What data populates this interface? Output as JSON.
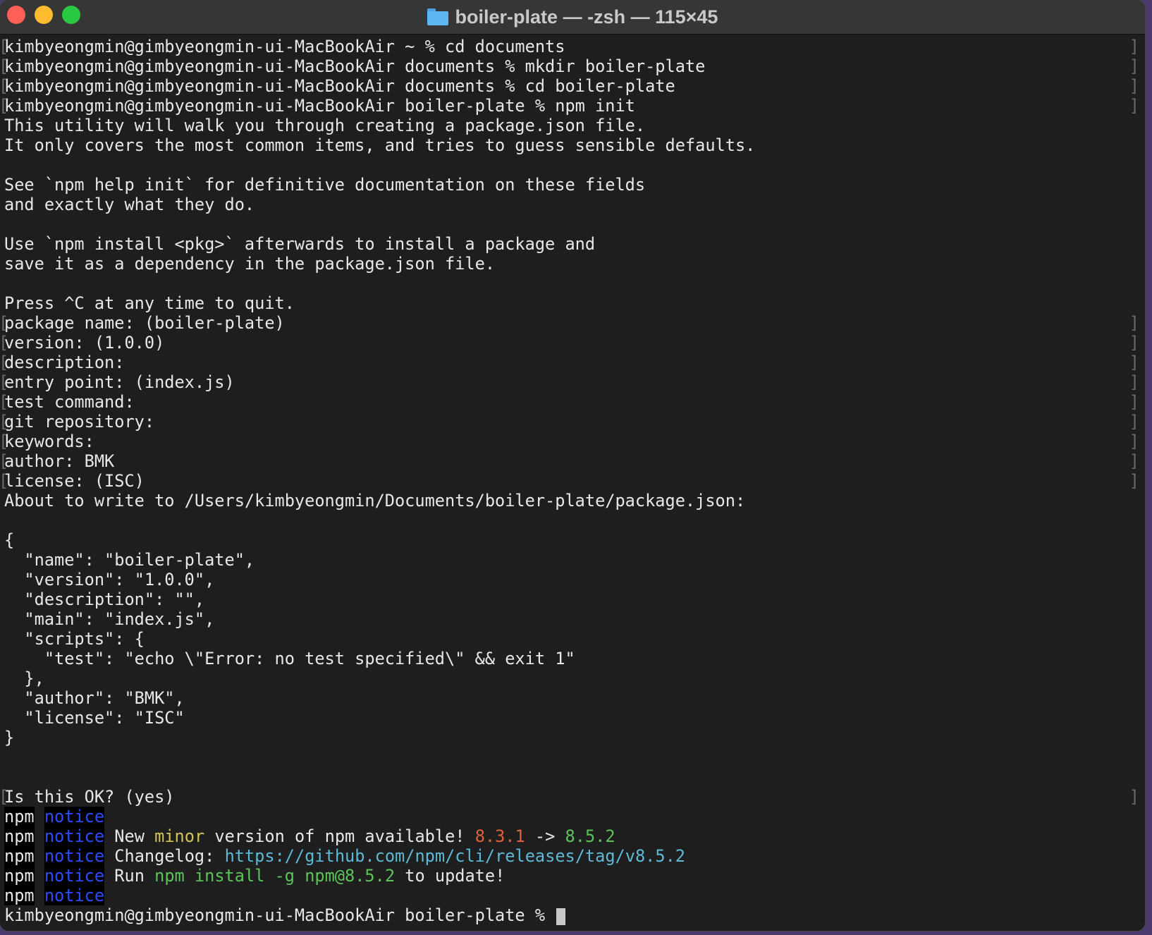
{
  "window": {
    "title": "boiler-plate — -zsh — 115×45"
  },
  "terminal": {
    "lines": [
      {
        "text": "kimbyeongmin@gimbyeongmin-ui-MacBookAir ~ % cd documents",
        "marked": true
      },
      {
        "text": "kimbyeongmin@gimbyeongmin-ui-MacBookAir documents % mkdir boiler-plate",
        "marked": true
      },
      {
        "text": "kimbyeongmin@gimbyeongmin-ui-MacBookAir documents % cd boiler-plate",
        "marked": true
      },
      {
        "text": "kimbyeongmin@gimbyeongmin-ui-MacBookAir boiler-plate % npm init",
        "marked": true
      },
      {
        "text": "This utility will walk you through creating a package.json file.",
        "marked": false
      },
      {
        "text": "It only covers the most common items, and tries to guess sensible defaults.",
        "marked": false
      },
      {
        "text": "",
        "marked": false
      },
      {
        "text": "See `npm help init` for definitive documentation on these fields",
        "marked": false
      },
      {
        "text": "and exactly what they do.",
        "marked": false
      },
      {
        "text": "",
        "marked": false
      },
      {
        "text": "Use `npm install <pkg>` afterwards to install a package and",
        "marked": false
      },
      {
        "text": "save it as a dependency in the package.json file.",
        "marked": false
      },
      {
        "text": "",
        "marked": false
      },
      {
        "text": "Press ^C at any time to quit.",
        "marked": false
      },
      {
        "text": "package name: (boiler-plate)",
        "marked": true
      },
      {
        "text": "version: (1.0.0)",
        "marked": true
      },
      {
        "text": "description:",
        "marked": true
      },
      {
        "text": "entry point: (index.js)",
        "marked": true
      },
      {
        "text": "test command:",
        "marked": true
      },
      {
        "text": "git repository:",
        "marked": true
      },
      {
        "text": "keywords:",
        "marked": true
      },
      {
        "text": "author: BMK",
        "marked": true
      },
      {
        "text": "license: (ISC)",
        "marked": true
      },
      {
        "text": "About to write to /Users/kimbyeongmin/Documents/boiler-plate/package.json:",
        "marked": false
      },
      {
        "text": "",
        "marked": false
      },
      {
        "text": "{",
        "marked": false
      },
      {
        "text": "  \"name\": \"boiler-plate\",",
        "marked": false
      },
      {
        "text": "  \"version\": \"1.0.0\",",
        "marked": false
      },
      {
        "text": "  \"description\": \"\",",
        "marked": false
      },
      {
        "text": "  \"main\": \"index.js\",",
        "marked": false
      },
      {
        "text": "  \"scripts\": {",
        "marked": false
      },
      {
        "text": "    \"test\": \"echo \\\"Error: no test specified\\\" && exit 1\"",
        "marked": false
      },
      {
        "text": "  },",
        "marked": false
      },
      {
        "text": "  \"author\": \"BMK\",",
        "marked": false
      },
      {
        "text": "  \"license\": \"ISC\"",
        "marked": false
      },
      {
        "text": "}",
        "marked": false
      },
      {
        "text": "",
        "marked": false
      },
      {
        "text": "",
        "marked": false
      },
      {
        "text": "Is this OK? (yes)",
        "marked": true
      }
    ],
    "npm_notices": {
      "npm_label": "npm",
      "notice_label": "notice",
      "update_line": {
        "prefix": "New ",
        "minor": "minor",
        "mid": " version of npm available! ",
        "old_version": "8.3.1",
        "arrow": " -> ",
        "new_version": "8.5.2"
      },
      "changelog_line": {
        "prefix": "Changelog: ",
        "url": "https://github.com/npm/cli/releases/tag/v8.5.2"
      },
      "run_line": {
        "prefix": "Run ",
        "command": "npm install -g npm@8.5.2",
        "suffix": " to update!"
      }
    },
    "prompt": "kimbyeongmin@gimbyeongmin-ui-MacBookAir boiler-plate % "
  }
}
